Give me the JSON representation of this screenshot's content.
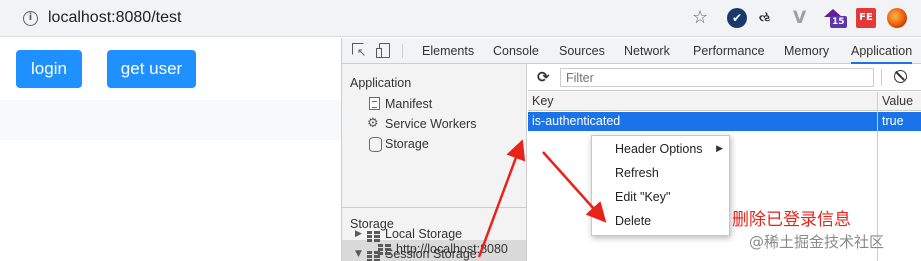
{
  "browser": {
    "url": "localhost:8080/test",
    "info_glyph": "i",
    "star_glyph": "☆",
    "extensions": [
      {
        "name": "check-ext",
        "glyph": "✔"
      },
      {
        "name": "translate-ext",
        "glyph": "ઌ"
      },
      {
        "name": "vue-ext",
        "glyph": "V"
      },
      {
        "name": "mortarboard-ext",
        "badge": "15"
      },
      {
        "name": "fe-ext",
        "glyph": "FE"
      },
      {
        "name": "planet-ext"
      }
    ]
  },
  "page": {
    "buttons": {
      "login": "login",
      "get_user": "get user"
    }
  },
  "devtools": {
    "tabs": [
      "Elements",
      "Console",
      "Sources",
      "Network",
      "Performance",
      "Memory",
      "Application"
    ],
    "active_tab": "Application",
    "sidebar": {
      "application_title": "Application",
      "application_items": [
        "Manifest",
        "Service Workers",
        "Storage"
      ],
      "storage_title": "Storage",
      "storage_items": [
        "Local Storage",
        "Session Storage"
      ],
      "session_child": "http://localhost:8080"
    },
    "toolbar": {
      "filter_placeholder": "Filter",
      "refresh_glyph": "C"
    },
    "table": {
      "columns": [
        "Key",
        "Value"
      ],
      "rows": [
        {
          "key": "is-authenticated",
          "value": "true"
        }
      ]
    },
    "context_menu": {
      "items": [
        "Header Options",
        "Refresh",
        "Edit \"Key\"",
        "Delete"
      ],
      "submenu_glyph": "▶"
    }
  },
  "annotation": {
    "text": "删除已登录信息",
    "watermark": "@稀土掘金技术社区",
    "color": "#e8231a"
  },
  "colors": {
    "accent": "#1a73e8",
    "button": "#1e90ff",
    "arrow": "#e8231a"
  }
}
